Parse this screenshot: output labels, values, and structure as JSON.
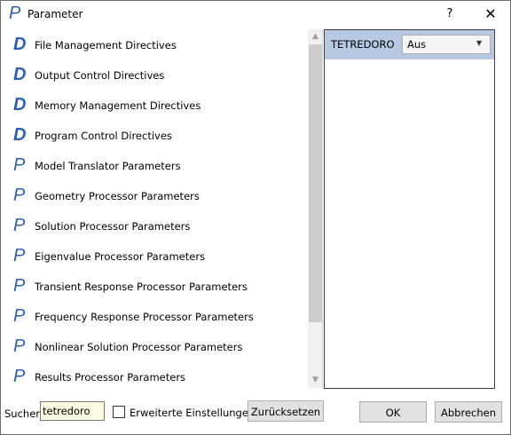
{
  "window": {
    "title": "Parameter",
    "title_icon": "P",
    "help_label": "?",
    "close_label": "✕"
  },
  "list": {
    "items": [
      {
        "icon": "D",
        "label": "File Management Directives"
      },
      {
        "icon": "D",
        "label": "Output Control Directives"
      },
      {
        "icon": "D",
        "label": "Memory Management Directives"
      },
      {
        "icon": "D",
        "label": "Program Control Directives"
      },
      {
        "icon": "P",
        "label": "Model Translator Parameters"
      },
      {
        "icon": "P",
        "label": "Geometry Processor Parameters"
      },
      {
        "icon": "P",
        "label": "Solution Processor Parameters"
      },
      {
        "icon": "P",
        "label": "Eigenvalue Processor Parameters"
      },
      {
        "icon": "P",
        "label": "Transient Response Processor Parameters"
      },
      {
        "icon": "P",
        "label": "Frequency Response Processor Parameters"
      },
      {
        "icon": "P",
        "label": "Nonlinear Solution Processor Parameters"
      },
      {
        "icon": "P",
        "label": "Results Processor Parameters"
      }
    ],
    "scroll_up": "▲",
    "scroll_down": "▼"
  },
  "properties": {
    "rows": [
      {
        "name": "TETREDORO",
        "value": "Aus"
      }
    ],
    "dropdown_arrow": "▼"
  },
  "footer": {
    "search_label": "Suchen",
    "search_value": "tetredoro",
    "advanced_label": "Erweiterte Einstellungen",
    "advanced_checked": false,
    "reset_label": "Zurücksetzen",
    "ok_label": "OK",
    "cancel_label": "Abbrechen"
  },
  "colors": {
    "accent": "#2b5fb1",
    "selected_row": "#b7c9e2",
    "search_bg": "#fbfbe4"
  }
}
